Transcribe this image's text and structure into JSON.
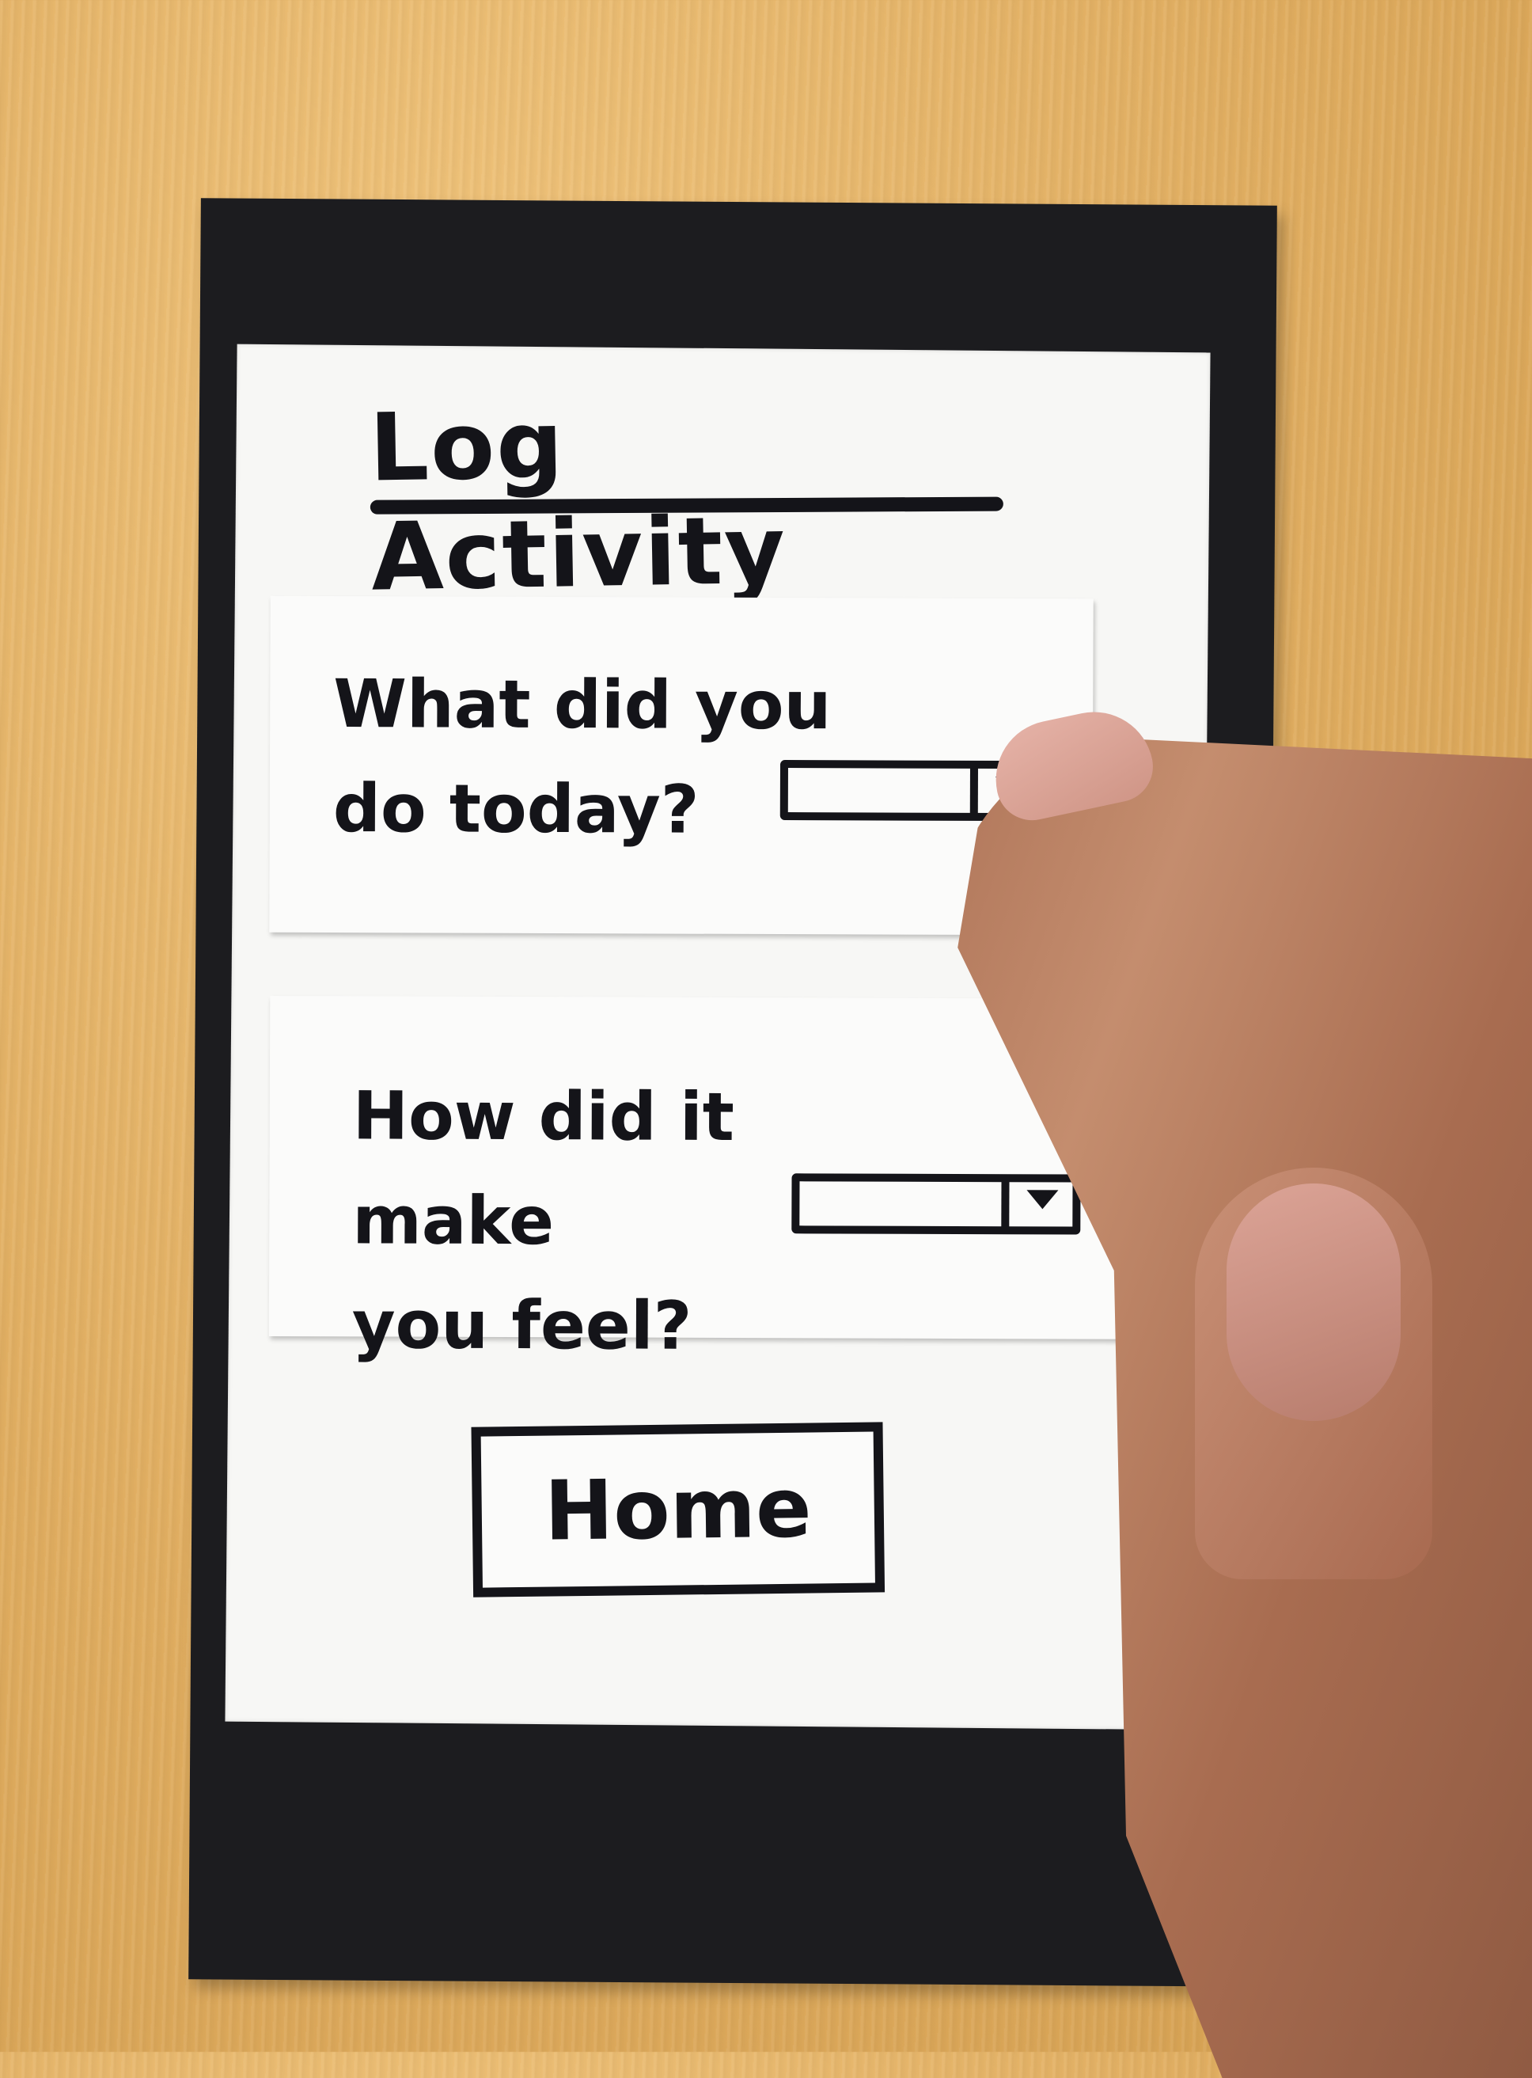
{
  "screen": {
    "title": "Log Activity",
    "question_1": {
      "line_1": "What did you",
      "line_2": "do today?",
      "dropdown_value": ""
    },
    "question_2": {
      "line_1": "How did it make",
      "line_2": "you feel?",
      "dropdown_value": ""
    },
    "home_button_label": "Home"
  },
  "colors": {
    "ink": "#141419",
    "paper": "#f7f7f5",
    "frame": "#1c1c1f",
    "table": "#e3b266"
  },
  "icons": {
    "dropdown_arrow": "chevron-down-icon"
  }
}
